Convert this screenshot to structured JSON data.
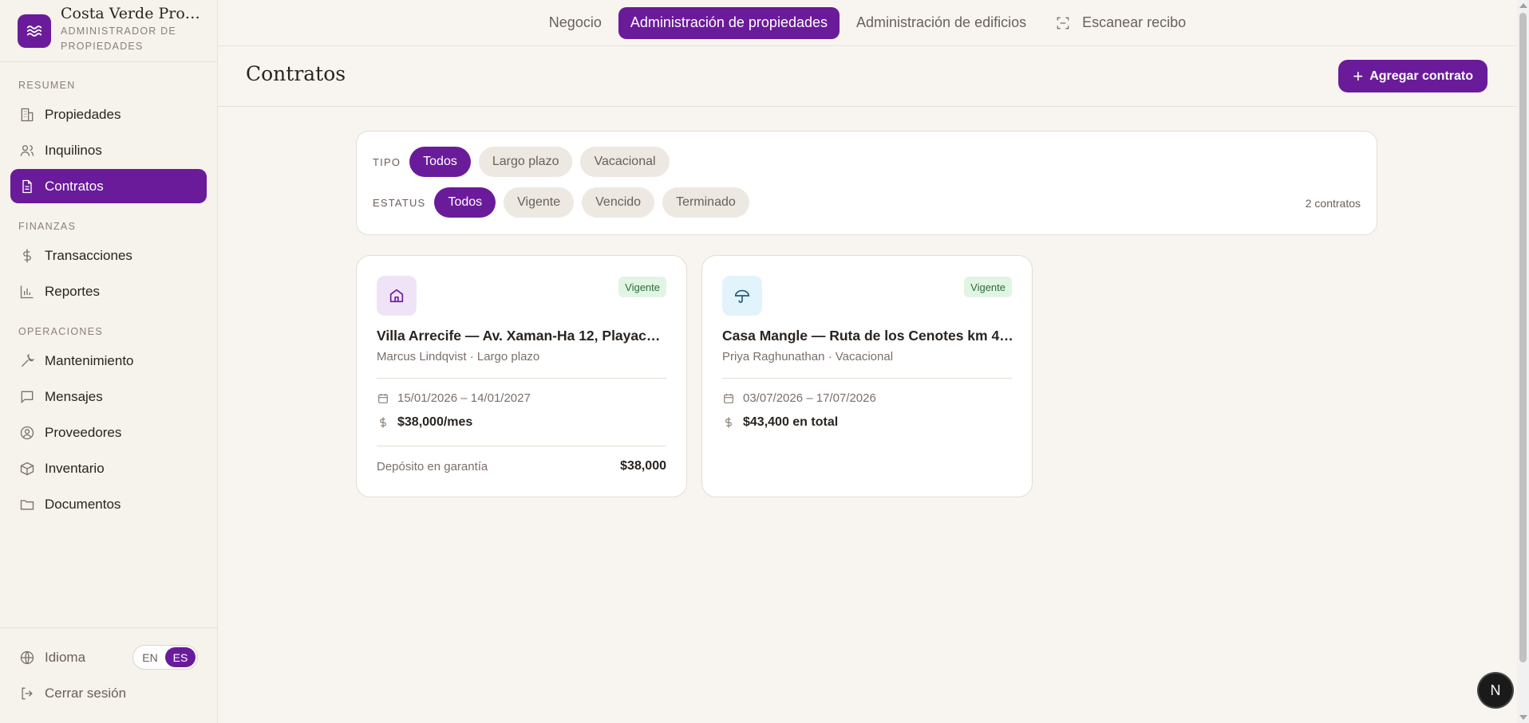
{
  "brand": {
    "name": "Costa Verde Proper...",
    "subtitle": "ADMINISTRADOR DE PROPIEDADES"
  },
  "sidebar": {
    "sections": [
      {
        "title": "RESUMEN",
        "items": [
          {
            "label": "Propiedades",
            "icon": "building-icon"
          },
          {
            "label": "Inquilinos",
            "icon": "users-icon"
          },
          {
            "label": "Contratos",
            "icon": "document-icon",
            "active": true
          }
        ]
      },
      {
        "title": "FINANZAS",
        "items": [
          {
            "label": "Transacciones",
            "icon": "dollar-icon"
          },
          {
            "label": "Reportes",
            "icon": "bar-chart-icon"
          }
        ]
      },
      {
        "title": "OPERACIONES",
        "items": [
          {
            "label": "Mantenimiento",
            "icon": "wrench-icon"
          },
          {
            "label": "Mensajes",
            "icon": "message-icon"
          },
          {
            "label": "Proveedores",
            "icon": "user-circle-icon"
          },
          {
            "label": "Inventario",
            "icon": "box-icon"
          },
          {
            "label": "Documentos",
            "icon": "folder-icon"
          }
        ]
      }
    ],
    "footer": {
      "language_label": "Idioma",
      "lang_en": "EN",
      "lang_es": "ES",
      "logout_label": "Cerrar sesión"
    }
  },
  "topnav": {
    "tabs": [
      "Negocio",
      "Administración de propiedades",
      "Administración de edificios",
      "Escanear recibo"
    ],
    "active": "Administración de propiedades"
  },
  "header": {
    "title": "Contratos",
    "add_button": "Agregar contrato"
  },
  "filters": {
    "tipo_label": "TIPO",
    "tipo_options": [
      "Todos",
      "Largo plazo",
      "Vacacional"
    ],
    "estatus_label": "ESTATUS",
    "estatus_options": [
      "Todos",
      "Vigente",
      "Vencido",
      "Terminado"
    ],
    "count": "2 contratos"
  },
  "contracts": [
    {
      "status": "Vigente",
      "title": "Villa Arrecife — Av. Xaman-Ha 12, Playacar ...",
      "subtitle": "Marcus Lindqvist · Largo plazo",
      "dates": "15/01/2026 – 14/01/2027",
      "amount": "$38,000/mes",
      "deposit_label": "Depósito en garantía",
      "deposit_value": "$38,000",
      "icon": "home-icon",
      "icon_bg": "#efe4f7",
      "icon_color": "#6a1b9a"
    },
    {
      "status": "Vigente",
      "title": "Casa Mangle — Ruta de los Cenotes km 4, ...",
      "subtitle": "Priya Raghunathan · Vacacional",
      "dates": "03/07/2026 – 17/07/2026",
      "amount": "$43,400 en total",
      "icon": "umbrella-icon",
      "icon_bg": "#e2f3fb",
      "icon_color": "#1c5c7a"
    }
  ],
  "floating_badge": "N",
  "colors": {
    "accent": "#6a1b9a",
    "badge_bg": "#e1f5e4",
    "badge_text": "#2e6b3a",
    "background": "#f8f5f0"
  }
}
